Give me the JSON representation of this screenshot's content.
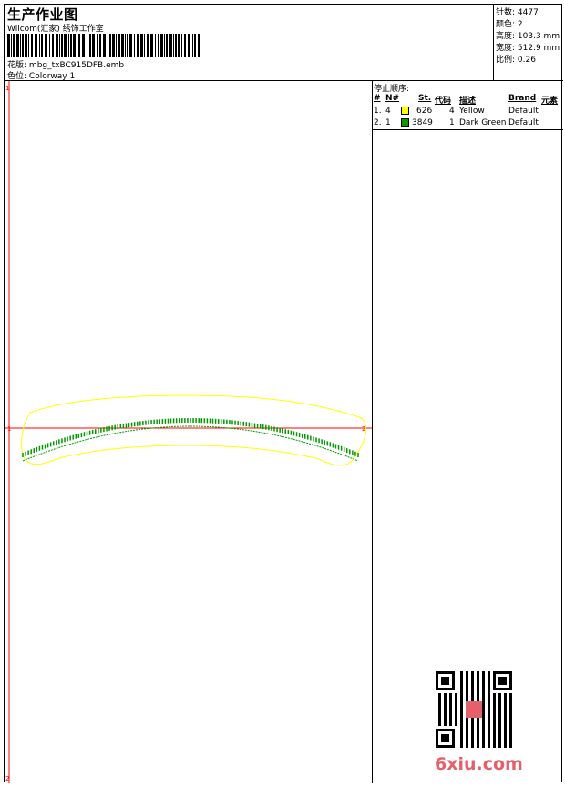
{
  "header": {
    "title": "生产作业图",
    "company": "Wilcom(汇家) 绣饰工作室",
    "design_label": "花版:",
    "design_value": "mbg_txBC915DFB.emb",
    "colorway_label": "色位:",
    "colorway_value": "Colorway 1"
  },
  "stats": [
    {
      "label": "针数:",
      "value": "4477"
    },
    {
      "label": "颜色:",
      "value": "2"
    },
    {
      "label": "高度:",
      "value": "103.3 mm"
    },
    {
      "label": "宽度:",
      "value": "512.9 mm"
    },
    {
      "label": "比例:",
      "value": "0.26"
    }
  ],
  "color_sequence": {
    "title": "停止顺序:",
    "columns": [
      "#",
      "N#",
      "St.",
      "代码",
      "描述",
      "Brand",
      "元素"
    ],
    "rows": [
      {
        "index": "1.",
        "needle": "4",
        "stitches": "626",
        "code": "4",
        "description": "Yellow",
        "brand": "Default",
        "color": "#ffff00"
      },
      {
        "index": "2.",
        "needle": "1",
        "stitches": "3849",
        "code": "1",
        "description": "Dark Green",
        "brand": "Default",
        "color": "#009900"
      }
    ]
  },
  "markers": {
    "left_mark": "1",
    "right_mark": "2",
    "top_mark": "1",
    "bottom_mark": "2"
  },
  "watermark": {
    "text": "6xiu.com"
  },
  "colors": {
    "guide": "#ff0000",
    "outline": "#ffff00",
    "stitch": "#009900"
  }
}
